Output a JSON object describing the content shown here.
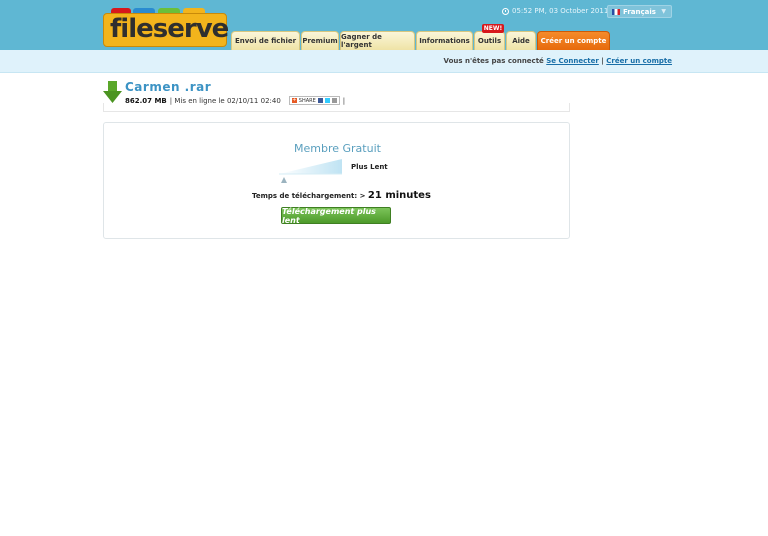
{
  "header": {
    "logo_text": "fileserve",
    "datetime": "05:52 PM, 03 October 2011 EST",
    "language": "Français",
    "new_badge": "NEW!",
    "nav": [
      {
        "label": "Envoi de fichier",
        "width": 69
      },
      {
        "label": "Premium",
        "width": 38
      },
      {
        "label": "Gagner de l'argent",
        "width": 75
      },
      {
        "label": "Informations",
        "width": 57
      },
      {
        "label": "Outils",
        "width": 31
      },
      {
        "label": "Aide",
        "width": 30
      },
      {
        "label": "Créer un compte",
        "width": 73
      }
    ]
  },
  "login": {
    "not_connected": "Vous n'êtes pas connecté",
    "connect_link": "Se Connecter",
    "separator": "|",
    "create_link": "Créer un compte"
  },
  "file": {
    "name": "Carmen .rar",
    "size": "862.07 MB",
    "uploaded": "| Mis en ligne le 02/10/11 02:40",
    "share_label": "SHARE",
    "trailing_sep": "|"
  },
  "download": {
    "member_type": "Membre Gratuit",
    "speed_label": "Plus Lent",
    "time_label": "Temps de téléchargement: >",
    "time_value": "21 minutes",
    "button_label": "Téléchargement plus lent"
  },
  "colors": {
    "header_bg": "#5fb7d3",
    "accent_orange": "#e76a0c",
    "link_blue": "#1a6fa8",
    "button_green": "#4d9a2a"
  }
}
